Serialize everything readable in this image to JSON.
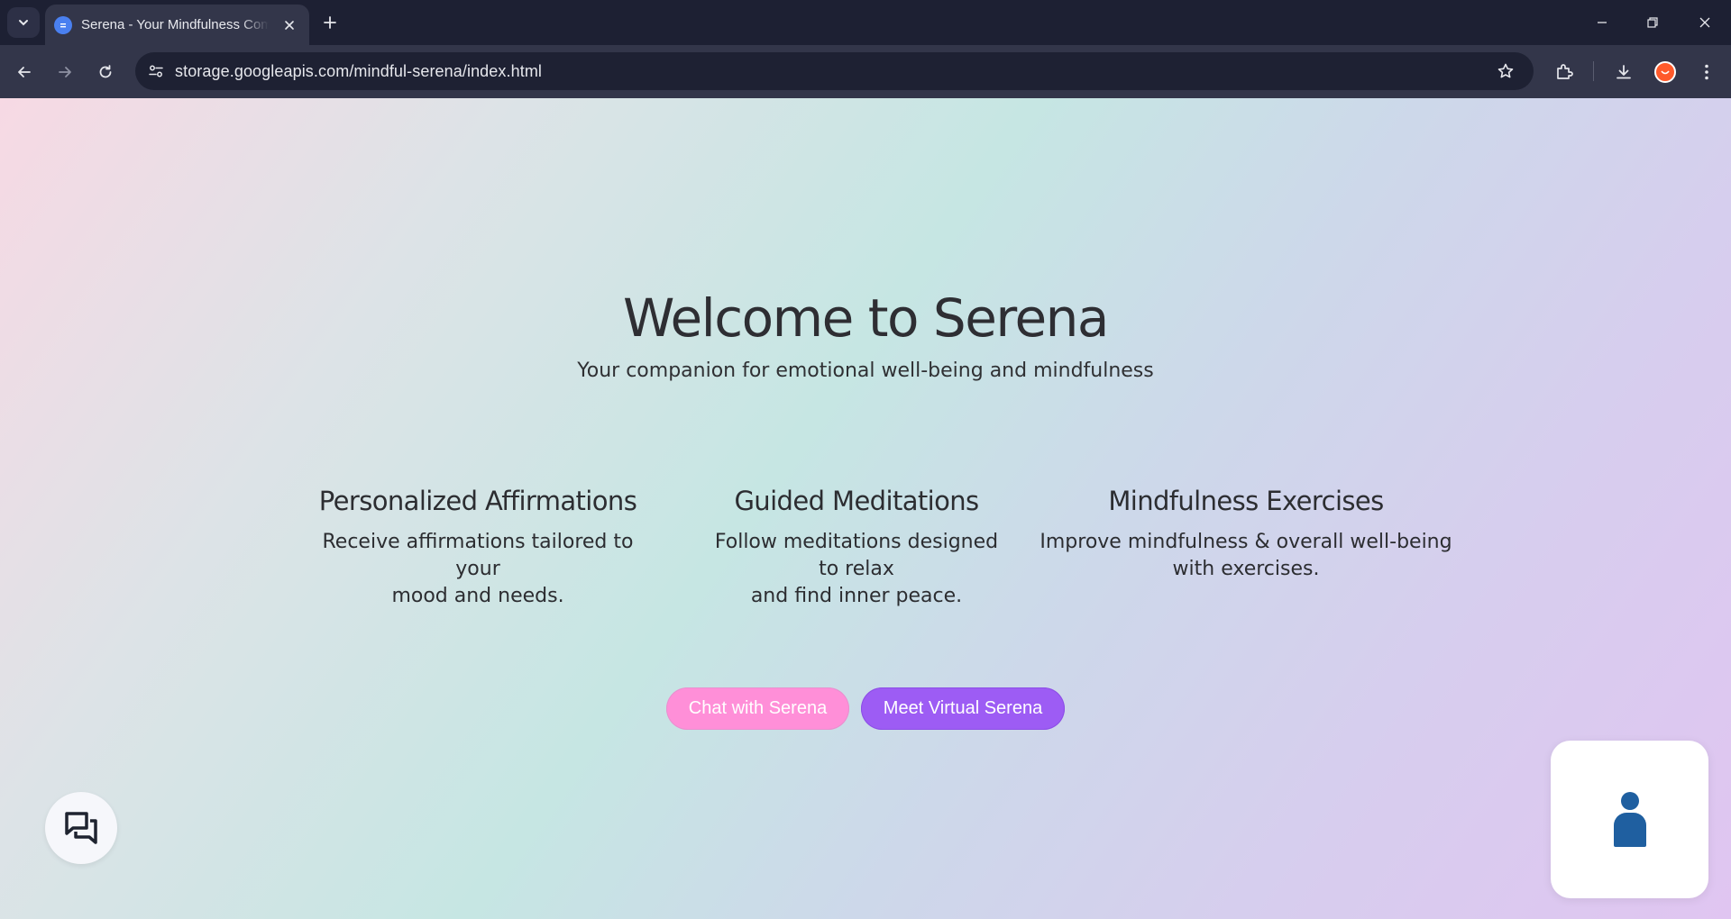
{
  "browser": {
    "tab_title": "Serena - Your Mindfulness Companion",
    "url": "storage.googleapis.com/mindful-serena/index.html"
  },
  "page": {
    "title": "Welcome to Serena",
    "subtitle": "Your companion for emotional well-being and mindfulness",
    "features": [
      {
        "title": "Personalized Affirmations",
        "lines": [
          "Receive affirmations tailored to your",
          "mood and needs."
        ]
      },
      {
        "title": "Guided Meditations",
        "lines": [
          "Follow meditations designed",
          "to relax",
          "and find inner peace."
        ]
      },
      {
        "title": "Mindfulness Exercises",
        "lines": [
          "Improve mindfulness & overall well-being",
          "with exercises."
        ]
      }
    ],
    "buttons": {
      "chat": "Chat with Serena",
      "meet": "Meet Virtual Serena"
    }
  },
  "colors": {
    "chat_button": "#ff8fd8",
    "meet_button": "#9d5cf4",
    "avatar_figure": "#1f5fa0"
  },
  "icons": {
    "chat_fab": "forum-icon",
    "avatar_card": "person-icon"
  }
}
